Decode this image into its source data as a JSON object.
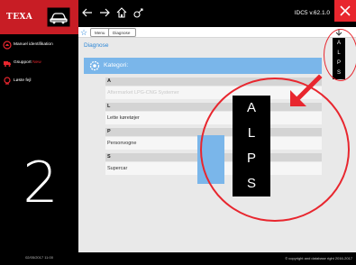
{
  "app": {
    "logo": "TEXA",
    "version": "IDC5 v.62.1.0",
    "date": "02/05/2017 11:00",
    "copyright": "© copyright and database right 2016-2017",
    "step_number": "2"
  },
  "sidebar": {
    "items": [
      {
        "label": "Manuel identifikation",
        "badge": ""
      },
      {
        "label": "Gsupport",
        "badge": "New"
      },
      {
        "label": "Løste fejl",
        "badge": ""
      }
    ]
  },
  "breadcrumb": [
    "Menu",
    "Diagnose"
  ],
  "content": {
    "title": "Diagnose",
    "category_label": "Kategori:",
    "groups": [
      {
        "letter": "A",
        "items": [
          "Aftermarket LPG-CNG Systemer"
        ]
      },
      {
        "letter": "L",
        "items": [
          "Lette køretøjer"
        ]
      },
      {
        "letter": "P",
        "items": [
          "Personvogne"
        ]
      },
      {
        "letter": "S",
        "items": [
          "Supercar"
        ]
      }
    ]
  },
  "alphabet_index": [
    "A",
    "L",
    "P",
    "S"
  ],
  "colors": {
    "accent": "#e8262e",
    "highlight": "#7ab6ea",
    "title": "#2d87d6"
  }
}
